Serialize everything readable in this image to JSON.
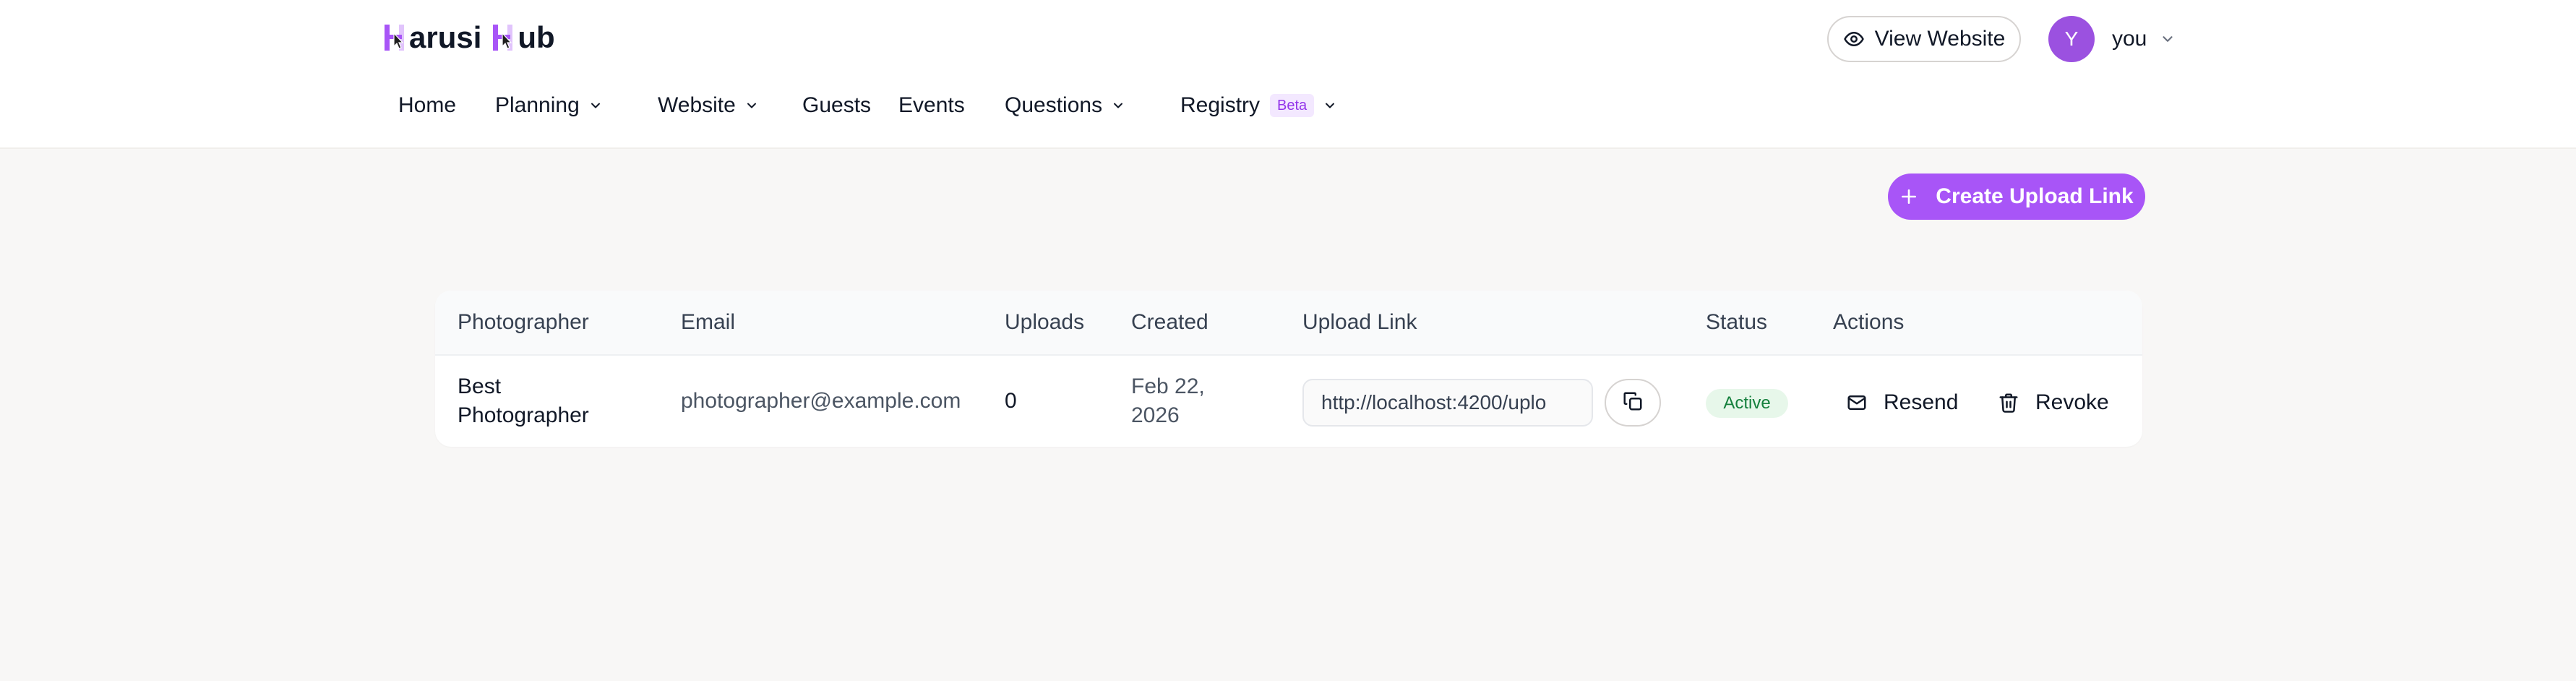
{
  "brand": {
    "logo_first": "arusi",
    "logo_second": "ub",
    "accent": "#a855f7"
  },
  "nav": {
    "items": [
      {
        "label": "Home",
        "has_menu": false
      },
      {
        "label": "Planning",
        "has_menu": true
      },
      {
        "label": "Website",
        "has_menu": true
      },
      {
        "label": "Guests",
        "has_menu": false
      },
      {
        "label": "Events",
        "has_menu": false
      },
      {
        "label": "Questions",
        "has_menu": true
      },
      {
        "label": "Registry",
        "has_menu": true,
        "badge": "Beta"
      }
    ]
  },
  "header": {
    "view_website_label": "View Website",
    "view_website_icon": "eye-icon",
    "user_initial": "Y",
    "user_name": "you"
  },
  "toolbar": {
    "create_label": "Create Upload Link",
    "create_icon": "plus-icon"
  },
  "table": {
    "columns": [
      "Photographer",
      "Email",
      "Uploads",
      "Created",
      "Upload Link",
      "Status",
      "Actions"
    ],
    "rows": [
      {
        "photographer_line1": "Best",
        "photographer_line2": "Photographer",
        "email": "photographer@example.com",
        "uploads": "0",
        "created_line1": "Feb 22,",
        "created_line2": "2026",
        "upload_link": "http://localhost:4200/uplo",
        "status": "Active",
        "resend_label": "Resend",
        "revoke_label": "Revoke"
      }
    ]
  },
  "colors": {
    "status_active_bg": "#e7f7ea",
    "status_active_text": "#15803d",
    "avatar_bg": "#9b51e0"
  }
}
